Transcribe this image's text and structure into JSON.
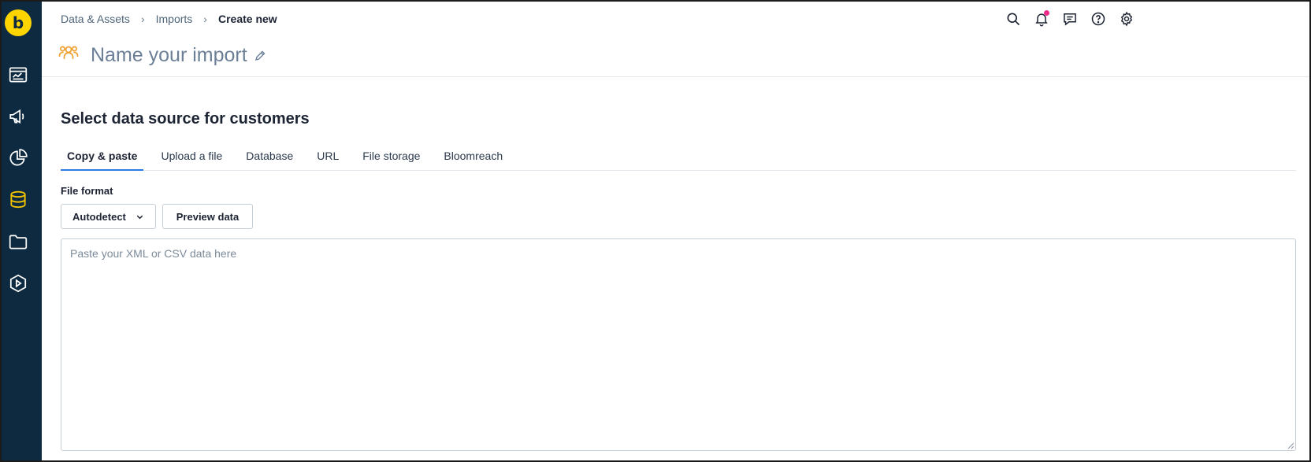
{
  "logo": {
    "glyph": "b"
  },
  "breadcrumb": {
    "items": [
      "Data & Assets",
      "Imports"
    ],
    "current": "Create new",
    "separator": "›"
  },
  "header": {
    "title": "Name your import"
  },
  "main": {
    "section_title": "Select data source for customers",
    "tabs": [
      {
        "label": "Copy & paste",
        "active": true
      },
      {
        "label": "Upload a file",
        "active": false
      },
      {
        "label": "Database",
        "active": false
      },
      {
        "label": "URL",
        "active": false
      },
      {
        "label": "File storage",
        "active": false
      },
      {
        "label": "Bloomreach",
        "active": false
      }
    ],
    "file_format_label": "File format",
    "file_format_selected": "Autodetect",
    "preview_label": "Preview data",
    "paste_placeholder": "Paste your XML or CSV data here"
  },
  "colors": {
    "sidebar": "#0e2a40",
    "logo": "#ffd500",
    "active_nav": "#f5c400",
    "accent_tab": "#2c7be5",
    "title_icon": "#f0a030",
    "notification_dot": "#f02c8a"
  },
  "icons": {
    "sidebar": [
      "dashboard-icon",
      "megaphone-icon",
      "pie-chart-icon",
      "database-icon",
      "folder-icon",
      "play-icon"
    ],
    "top": [
      "search-icon",
      "bell-icon",
      "chat-icon",
      "help-icon",
      "gear-icon"
    ]
  }
}
